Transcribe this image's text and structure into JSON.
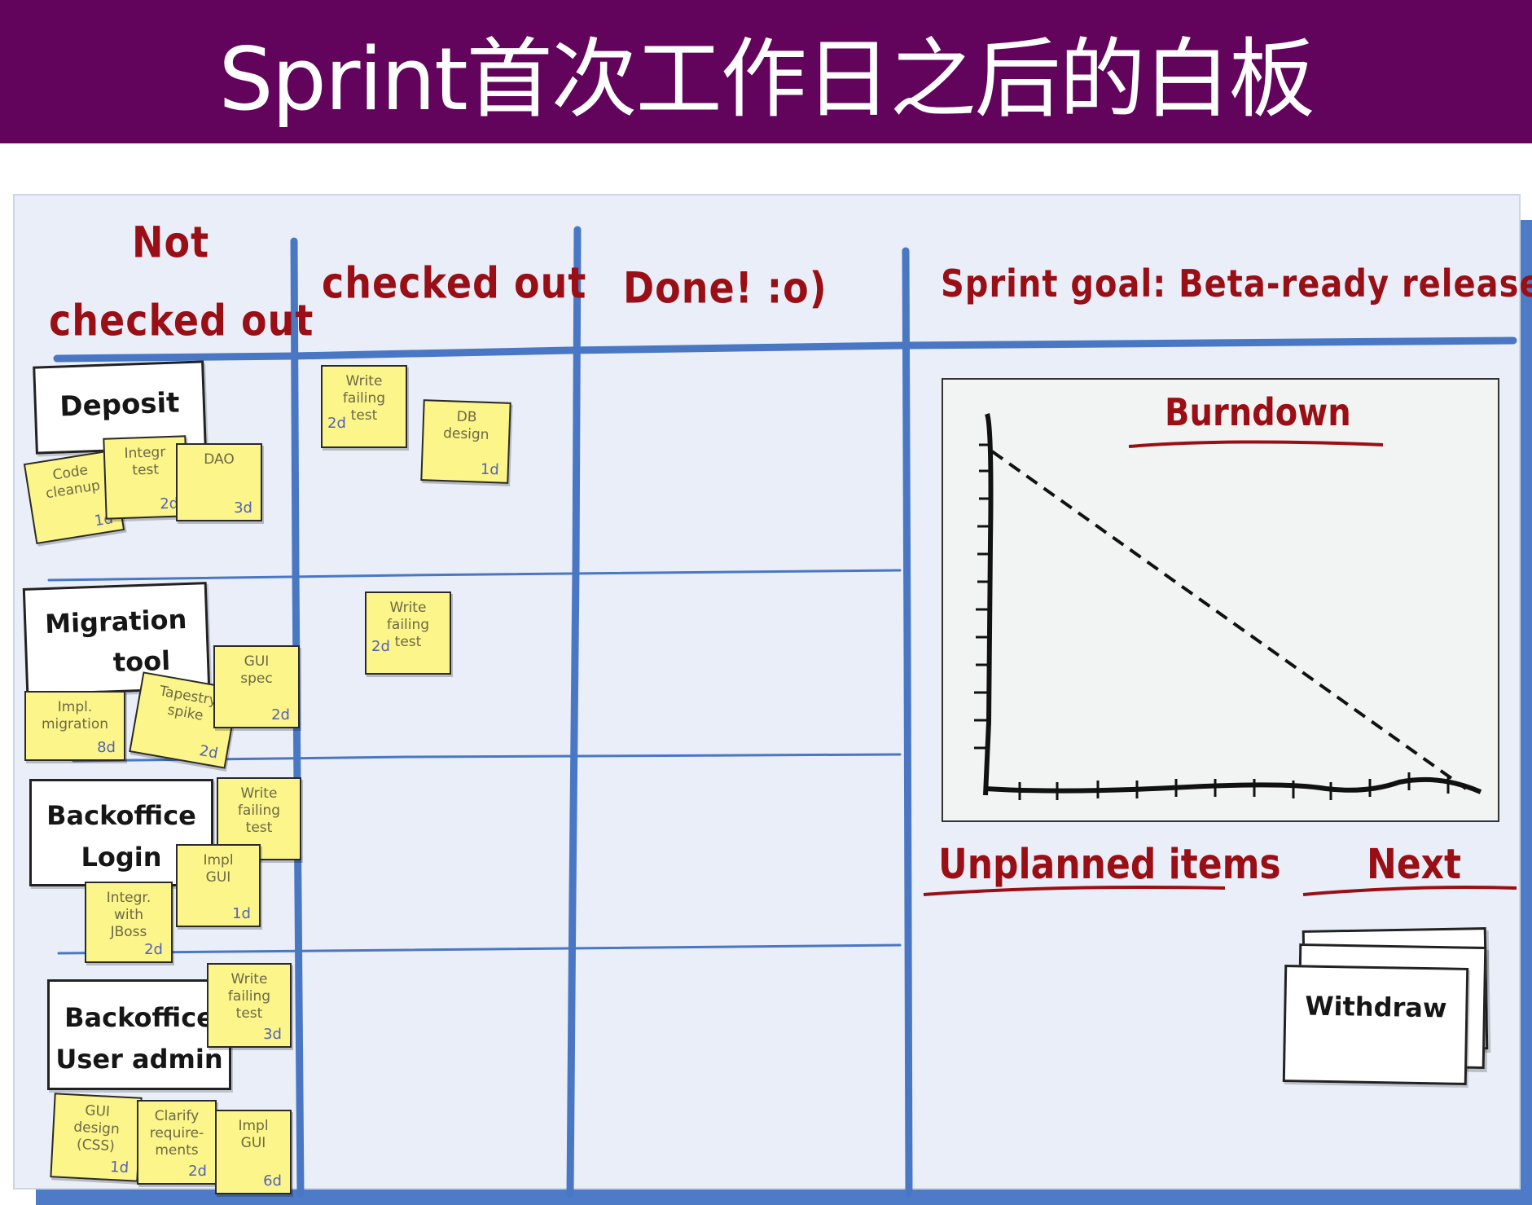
{
  "title": "Sprint首次工作日之后的白板",
  "columns": {
    "not_checked_out": [
      "Not",
      "checked out"
    ],
    "checked_out": "checked out",
    "done": "Done! :o)",
    "sprint_goal": "Sprint goal: Beta-ready release!"
  },
  "stories": [
    {
      "lines": [
        "Deposit"
      ],
      "notes": [
        {
          "text": "Code\ncleanup",
          "est": "1d"
        },
        {
          "text": "Integr\ntest",
          "est": "2d"
        },
        {
          "text": "DAO",
          "est": "3d"
        }
      ]
    },
    {
      "lines": [
        "Migration",
        "tool"
      ],
      "notes": [
        {
          "text": "Impl.\nmigration",
          "est": "8d"
        },
        {
          "text": "Tapestry\nspike",
          "est": "2d"
        },
        {
          "text": "GUI\nspec",
          "est": "2d"
        }
      ]
    },
    {
      "lines": [
        "Backoffice",
        "Login"
      ],
      "notes": [
        {
          "text": "Write\nfailing\ntest",
          "est": ""
        },
        {
          "text": "Impl\nGUI",
          "est": "1d"
        },
        {
          "text": "Integr.\nwith\nJBoss",
          "est": "2d"
        }
      ]
    },
    {
      "lines": [
        "Backoffice",
        "User admin"
      ],
      "notes": [
        {
          "text": "Write\nfailing\ntest",
          "est": "3d"
        },
        {
          "text": "GUI\ndesign\n(CSS)",
          "est": "1d"
        },
        {
          "text": "Clarify\nrequire-\nments",
          "est": "2d"
        },
        {
          "text": "Impl\nGUI",
          "est": "6d"
        }
      ]
    }
  ],
  "checked_out_notes": [
    {
      "text": "Write\nfailing\ntest",
      "est": "2d"
    },
    {
      "text": "DB\ndesign",
      "est": "1d"
    },
    {
      "text": "Write\nfailing\ntest",
      "est": "2d"
    }
  ],
  "burndown": {
    "title": "Burndown"
  },
  "unplanned_items": "Unplanned items",
  "next": "Next",
  "next_card": "Withdraw",
  "colors": {
    "header_bg": "#62045b",
    "board_line": "#4a77c4",
    "heading_red": "#9a0f15",
    "sticky": "#fbf58a"
  }
}
